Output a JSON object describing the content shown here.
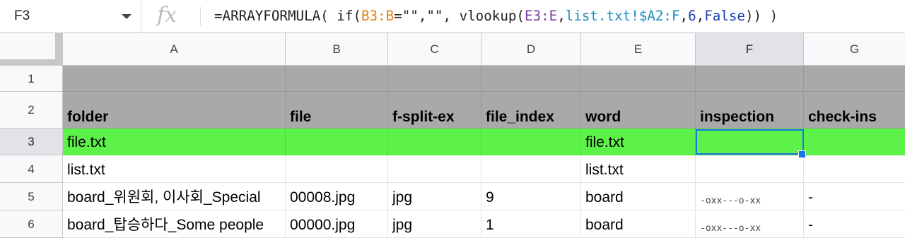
{
  "formula_bar": {
    "cell_ref": "F3",
    "fx_label": "fx",
    "formula_tokens": [
      {
        "text": "=ARRAYFORMULA( if(",
        "color": ""
      },
      {
        "text": "B3:B",
        "color": "orange"
      },
      {
        "text": "=\"\",\"\", vlookup(",
        "color": ""
      },
      {
        "text": "E3:E",
        "color": "purple"
      },
      {
        "text": ",",
        "color": ""
      },
      {
        "text": "list.txt!$A2:F",
        "color": "teal"
      },
      {
        "text": ",",
        "color": ""
      },
      {
        "text": "6",
        "color": "blue"
      },
      {
        "text": ",",
        "color": ""
      },
      {
        "text": "False",
        "color": "blue"
      },
      {
        "text": ")) )",
        "color": ""
      }
    ]
  },
  "columns": [
    "A",
    "B",
    "C",
    "D",
    "E",
    "F",
    "G"
  ],
  "selected_column": "F",
  "rows": [
    {
      "num": "1",
      "cells": [
        "",
        "",
        "",
        "",
        "",
        "",
        ""
      ]
    },
    {
      "num": "2",
      "cells": [
        "folder",
        "file",
        "f-split-ex",
        "file_index",
        "word",
        "inspection",
        "check-ins"
      ]
    },
    {
      "num": "3",
      "cells": [
        "file.txt",
        "",
        "",
        "",
        "file.txt",
        "",
        ""
      ]
    },
    {
      "num": "4",
      "cells": [
        "list.txt",
        "",
        "",
        "",
        "list.txt",
        "",
        ""
      ]
    },
    {
      "num": "5",
      "cells": [
        "board_위원회, 이사회_Special",
        "00008.jpg",
        "jpg",
        "9",
        "board",
        "-oxx---o-xx",
        "-"
      ]
    },
    {
      "num": "6",
      "cells": [
        "board_탑승하다_Some people",
        "00000.jpg",
        "jpg",
        "1",
        "board",
        "-oxx---o-xx",
        "-"
      ]
    }
  ],
  "selected_row": "3",
  "colors": {
    "header_fill": "#a9a9a9",
    "highlight_fill": "#5cf24a",
    "selection": "#1a73e8"
  }
}
